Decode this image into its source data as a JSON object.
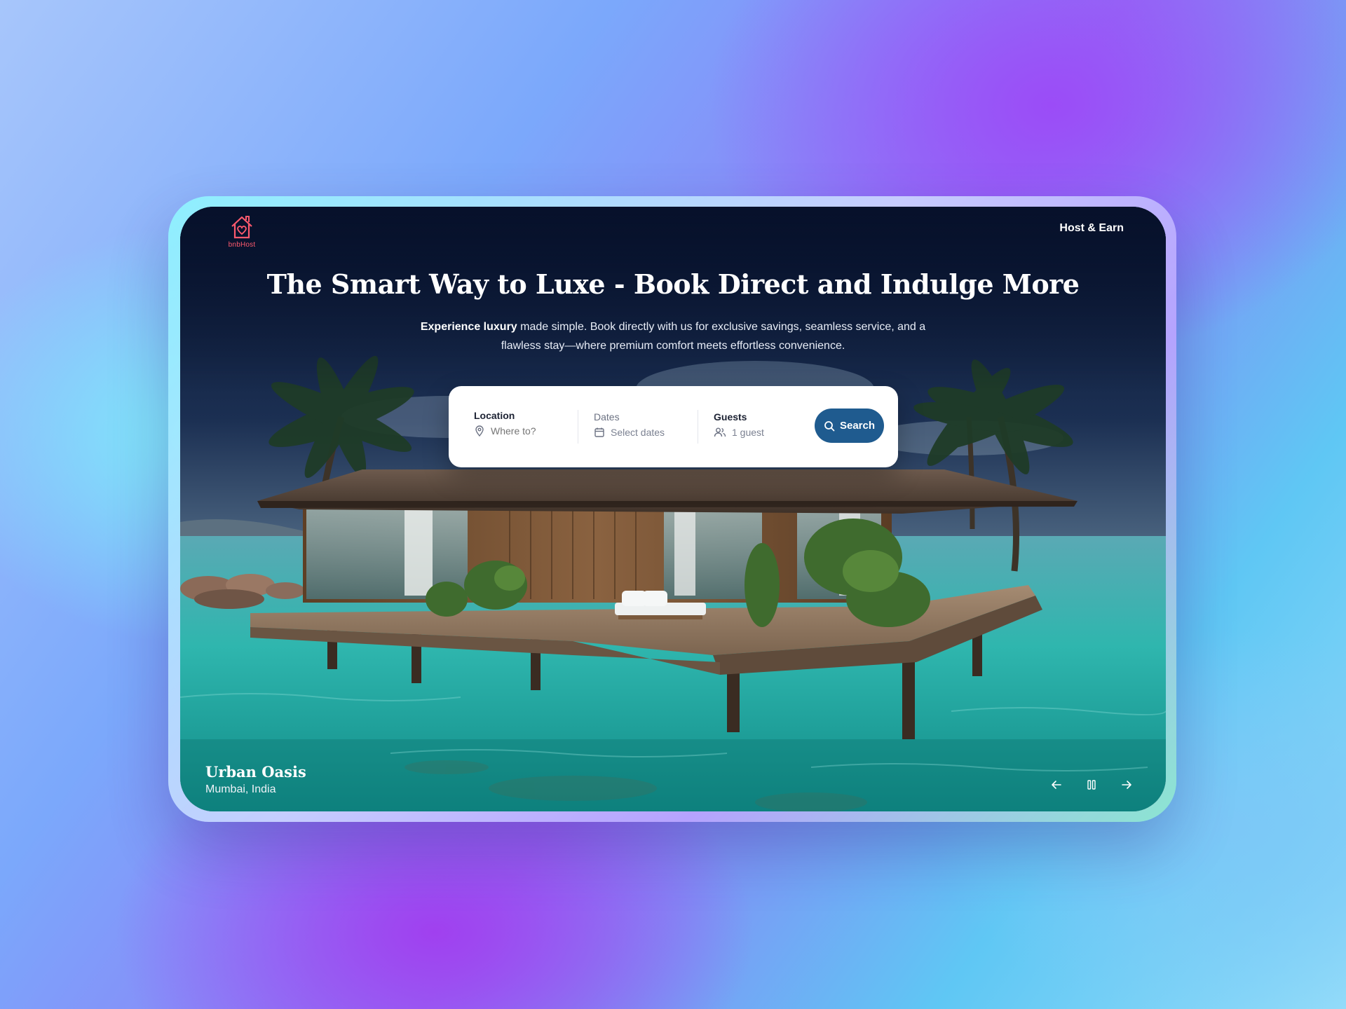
{
  "brand": {
    "logo_text": "bnbHost",
    "accent_color": "#ff5a6e"
  },
  "nav": {
    "host_link": "Host & Earn"
  },
  "hero": {
    "title": "The Smart Way to Luxe - Book Direct and Indulge More",
    "subtitle_emphasis": "Experience luxury",
    "subtitle_rest": " made simple. Book directly with us for exclusive savings, seamless service, and a flawless stay—where premium comfort meets effortless convenience."
  },
  "search": {
    "location_label": "Location",
    "location_placeholder": "Where to?",
    "dates_label": "Dates",
    "dates_value": "Select dates",
    "guests_label": "Guests",
    "guests_value": "1 guest",
    "button_label": "Search",
    "button_color": "#1f5b8f"
  },
  "slide": {
    "title": "Urban Oasis",
    "location": "Mumbai, India"
  },
  "slideshow_controls": {
    "prev_icon": "arrow-left-icon",
    "pause_icon": "pause-icon",
    "next_icon": "arrow-right-icon"
  }
}
